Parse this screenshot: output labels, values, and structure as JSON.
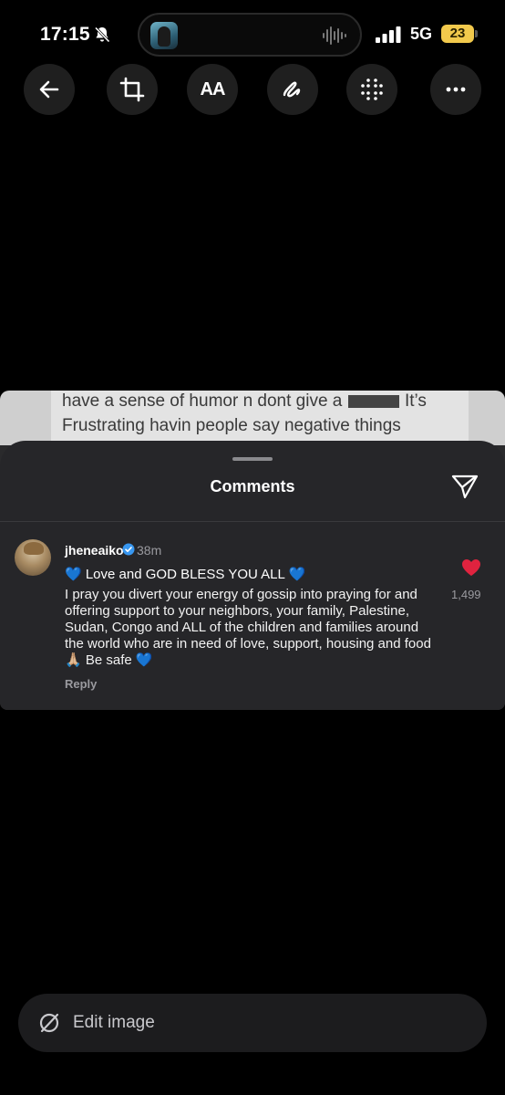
{
  "status_bar": {
    "time": "17:15",
    "network": "5G",
    "battery": "23",
    "icons": [
      "bell-slash-icon",
      "audio-wave-icon",
      "signal-icon"
    ]
  },
  "toolbar": {
    "buttons": [
      {
        "name": "back",
        "icon": "arrow-left-icon"
      },
      {
        "name": "crop",
        "icon": "crop-icon"
      },
      {
        "name": "text",
        "label": "AA",
        "icon": "text-icon"
      },
      {
        "name": "draw",
        "icon": "pen-scribble-icon"
      },
      {
        "name": "grid",
        "icon": "dots-grid-icon"
      },
      {
        "name": "more",
        "icon": "ellipsis-icon"
      }
    ]
  },
  "screenshot": {
    "tweet_lines": [
      "have a sense of humor n dont give a",
      "It’s",
      "Frustrating havin people say negative things"
    ]
  },
  "comments_sheet": {
    "title": "Comments",
    "comment": {
      "username": "jheneaiko",
      "time_ago": "38m",
      "first_line": "💙 Love and GOD BLESS YOU ALL 💙",
      "body": "I pray you divert your energy of gossip into praying for and offering support to your neighbors, your family, Palestine, Sudan, Congo and ALL of the children and families around the world who are in need of love, support, housing and food 🙏🏼 Be safe 💙",
      "reply_label": "Reply",
      "likes": "1,499",
      "heart_color": "#e0233f"
    }
  },
  "edit_bar": {
    "label": "Edit image",
    "icon": "edit-slash-icon"
  },
  "colors": {
    "background": "#000000",
    "sheet": "#262629",
    "battery": "#f2c94c",
    "verified": "#3897f0"
  }
}
